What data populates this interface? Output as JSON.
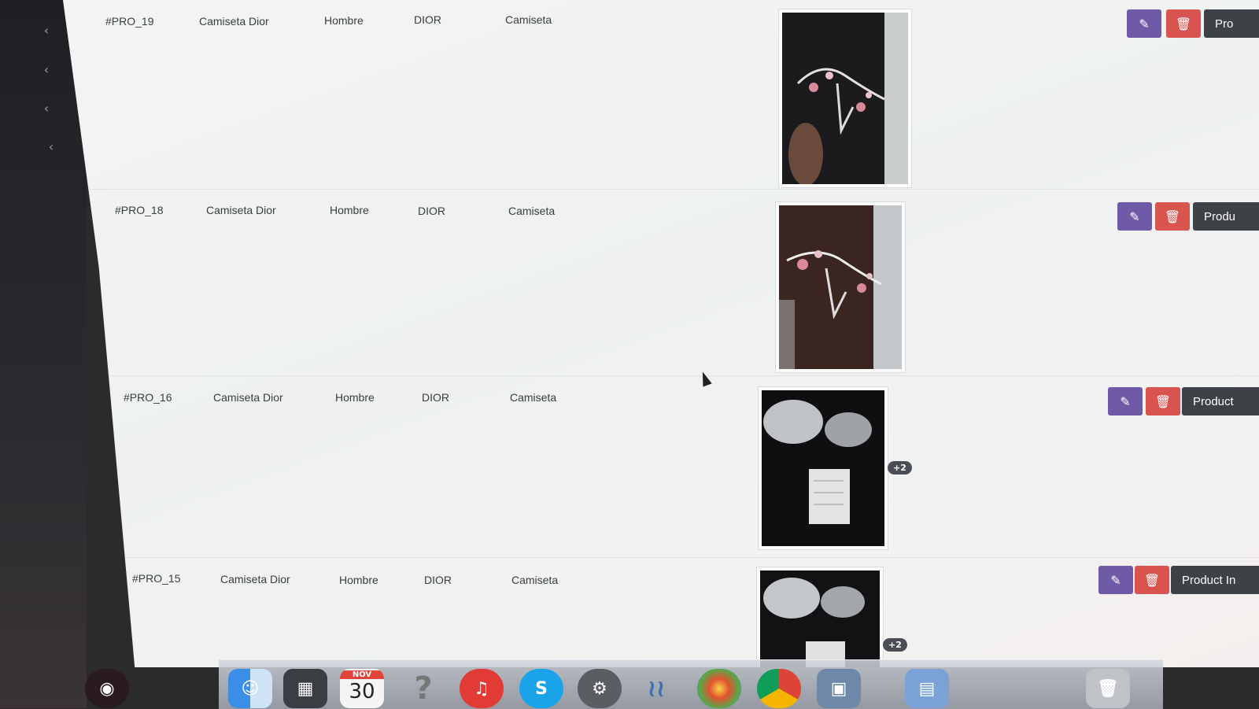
{
  "products": [
    {
      "id": "#PRO_19",
      "name": "Camiseta Dior",
      "gender": "Hombre",
      "brand": "DIOR",
      "category": "Camiseta",
      "extra_images": "",
      "product_label": "Pro"
    },
    {
      "id": "#PRO_18",
      "name": "Camiseta Dior",
      "gender": "Hombre",
      "brand": "DIOR",
      "category": "Camiseta",
      "extra_images": "",
      "product_label": "Produ"
    },
    {
      "id": "#PRO_16",
      "name": "Camiseta Dior",
      "gender": "Hombre",
      "brand": "DIOR",
      "category": "Camiseta",
      "extra_images": "+2",
      "product_label": "Product"
    },
    {
      "id": "#PRO_15",
      "name": "Camiseta Dior",
      "gender": "Hombre",
      "brand": "DIOR",
      "category": "Camiseta",
      "extra_images": "+2",
      "product_label": "Product In"
    }
  ],
  "actions": {
    "edit_icon": "pencil-square-icon",
    "delete_icon": "trash-icon"
  },
  "dock": {
    "calendar_month": "NOV",
    "calendar_day": "30",
    "apps": [
      "screen-recorder-icon",
      "finder-icon",
      "mission-control-icon",
      "calendar-icon",
      "help-icon",
      "itunes-icon",
      "skype-icon",
      "system-preferences-icon",
      "launchpad-icon",
      "photos-icon",
      "chrome-icon",
      "preview-icon",
      "documents-folder-icon",
      "trash-icon"
    ]
  },
  "colors": {
    "edit": "#6f5aa8",
    "delete": "#d9534f",
    "product": "#3e4146"
  }
}
